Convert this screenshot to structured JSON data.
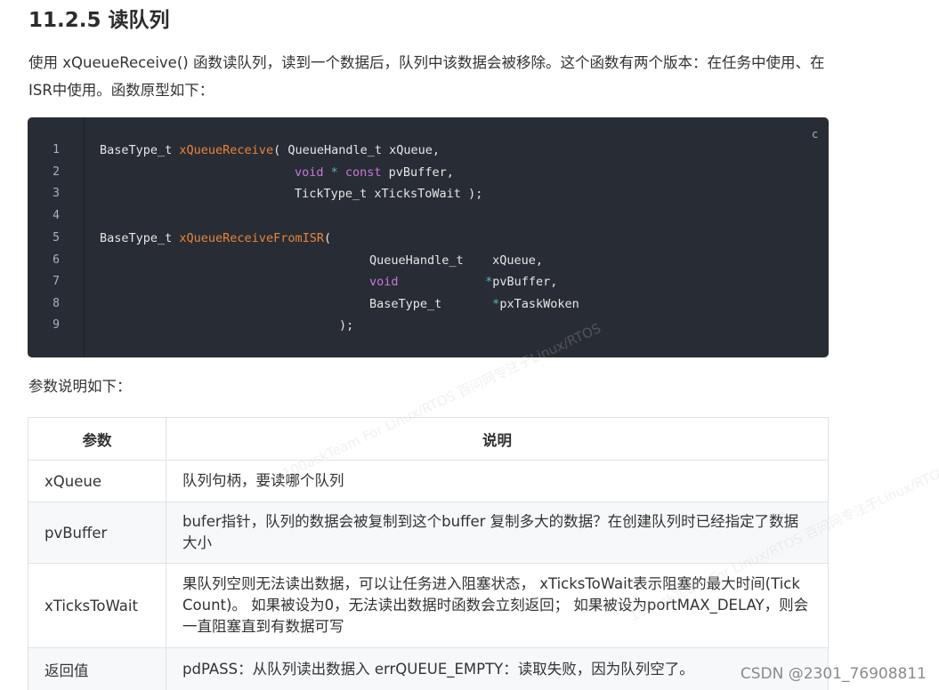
{
  "heading": "11.2.5 读队列",
  "intro": {
    "before_fn": "使用 ",
    "fn_name": "xQueueReceive()",
    "after_fn": " 函数读队列，读到一个数据后，队列中该数据会被移除。这个函数有两个版本：在任务中使用、在ISR中使用。函数原型如下："
  },
  "code": {
    "language_label": "c",
    "line_numbers": [
      "1",
      "2",
      "3",
      "4",
      "5",
      "6",
      "7",
      "8",
      "9"
    ],
    "lines": {
      "l1_type": "BaseType_t ",
      "l1_fn": "xQueueReceive",
      "l1_rest": "( QueueHandle_t xQueue,",
      "l2_kw": "void",
      "l2_op": " * ",
      "l2_kw2": "const",
      "l2_rest": " pvBuffer,",
      "l3": "TickType_t xTicksToWait );",
      "l5_type": "BaseType_t ",
      "l5_fn": "xQueueReceiveFromISR",
      "l5_rest": "(",
      "l6": "QueueHandle_t    xQueue,",
      "l7_kw": "void",
      "l7_pad": "            ",
      "l7_op": "*",
      "l7_rest": "pvBuffer,",
      "l8_type": "BaseType_t       ",
      "l8_op": "*",
      "l8_rest": "pxTaskWoken",
      "l9": ");"
    }
  },
  "params_caption": "参数说明如下：",
  "table": {
    "headers": [
      "参数",
      "说明"
    ],
    "rows": [
      {
        "name": "xQueue",
        "desc": "队列句柄，要读哪个队列"
      },
      {
        "name": "pvBuffer",
        "desc": "bufer指针，队列的数据会被复制到这个buffer 复制多大的数据？在创建队列时已经指定了数据大小"
      },
      {
        "name": "xTicksToWait",
        "desc": "果队列空则无法读出数据，可以让任务进入阻塞状态， xTicksToWait表示阻塞的最大时间(Tick Count)。 如果被设为0，无法读出数据时函数会立刻返回； 如果被设为portMAX_DELAY，则会一直阻塞直到有数据可写"
      },
      {
        "name": "返回值",
        "desc": "pdPASS：从队列读出数据入 errQUEUE_EMPTY：读取失败，因为队列空了。"
      }
    ]
  },
  "watermark_text": "100askTeam For Linux/RTOS 百问网专注于Linux/RTOS",
  "csdn_credit": "CSDN @2301_76908811",
  "colors": {
    "code_bg": "#282c34",
    "function_name": "#e8843c",
    "keyword": "#c678dd",
    "operator": "#56b6c2"
  }
}
